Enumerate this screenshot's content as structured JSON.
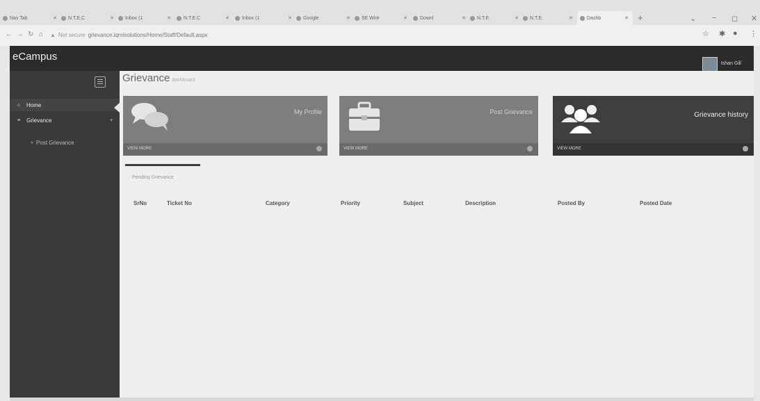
{
  "browser": {
    "tabs": [
      {
        "label": "Nav Tab"
      },
      {
        "label": "N.T.E.C"
      },
      {
        "label": "Inbox (1"
      },
      {
        "label": "N.T.E.C"
      },
      {
        "label": "Inbox (1"
      },
      {
        "label": "Google"
      },
      {
        "label": "SE Wire"
      },
      {
        "label": "Downl"
      },
      {
        "label": "N.T.E."
      },
      {
        "label": "N.T.E."
      },
      {
        "label": "Dashb"
      }
    ],
    "not_secure": "Not secure",
    "url": "grievance.iqmisolutions/Home/Staff/Default.aspx"
  },
  "header": {
    "brand": "eCampus",
    "username": "Ishan Gill"
  },
  "sidebar": {
    "items": [
      {
        "label": "Home"
      },
      {
        "label": "Grievance"
      },
      {
        "label": "Post Grievance"
      }
    ]
  },
  "main": {
    "title": "Grievance",
    "subtitle": "dashboard",
    "cards": [
      {
        "title": "My Profile",
        "footer": "VIEW MORE"
      },
      {
        "title": "Post Grievance",
        "footer": "VIEW MORE"
      },
      {
        "title": "Grievance history",
        "footer": "VIEW MORE"
      }
    ],
    "tab_label": "Pending Grievance",
    "table": {
      "columns": [
        "SrNo",
        "Ticket No",
        "Category",
        "Priority",
        "Subject",
        "Description",
        "Posted By",
        "Posted Date"
      ]
    }
  },
  "colors": {
    "header_bg": "#2b2b2b",
    "sidebar_bg": "#3a3a3b",
    "card_bg": "#7e7e7f",
    "card_dark_bg": "#3e3e40"
  }
}
